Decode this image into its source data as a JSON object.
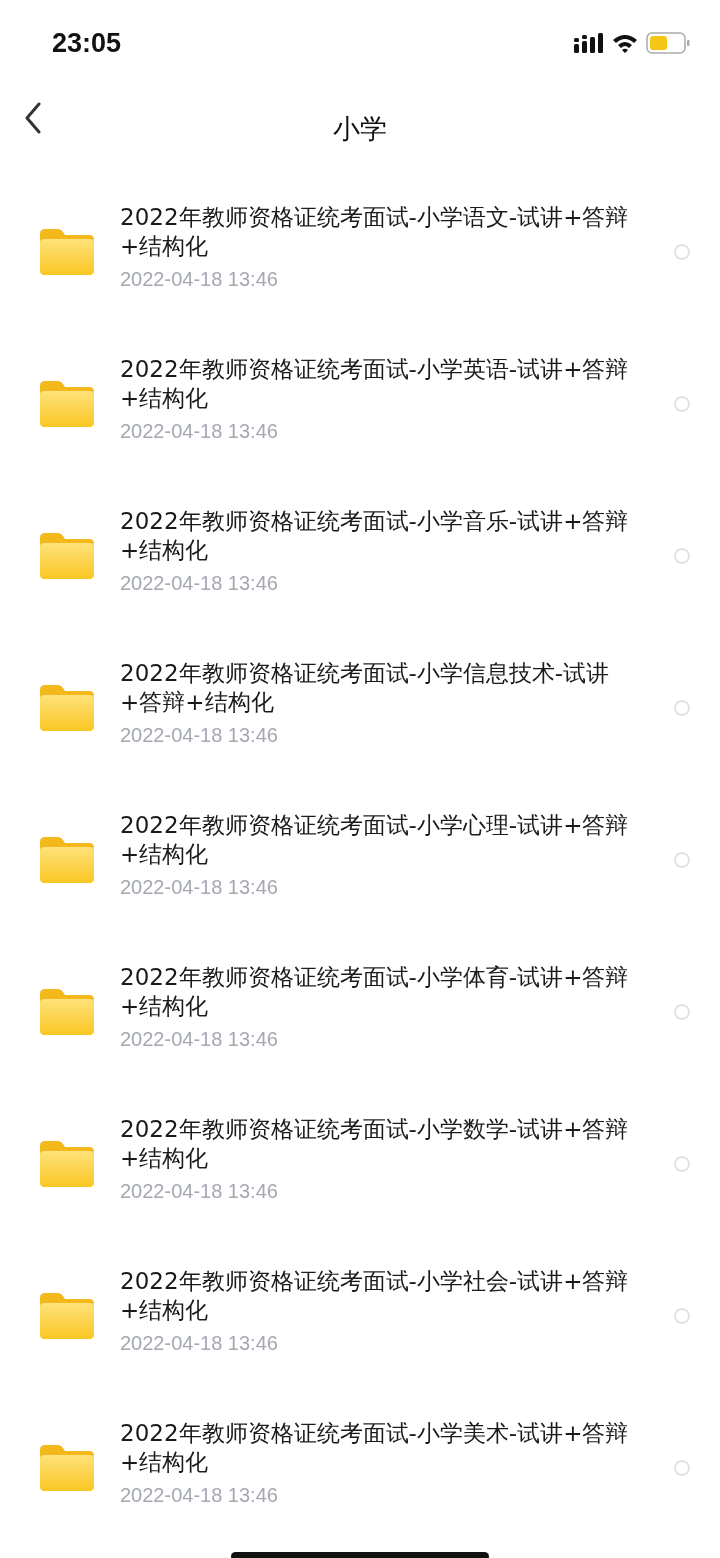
{
  "status_bar": {
    "time": "23:05"
  },
  "header": {
    "title": "小学"
  },
  "items": [
    {
      "name": "2022年教师资格证统考面试-小学语文-试讲+答辩+结构化",
      "date": "2022-04-18 13:46",
      "selected": false
    },
    {
      "name": "2022年教师资格证统考面试-小学英语-试讲+答辩+结构化",
      "date": "2022-04-18 13:46",
      "selected": false
    },
    {
      "name": "2022年教师资格证统考面试-小学音乐-试讲+答辩+结构化",
      "date": "2022-04-18 13:46",
      "selected": false
    },
    {
      "name": "2022年教师资格证统考面试-小学信息技术-试讲+答辩+结构化",
      "date": "2022-04-18 13:46",
      "selected": false
    },
    {
      "name": "2022年教师资格证统考面试-小学心理-试讲+答辩+结构化",
      "date": "2022-04-18 13:46",
      "selected": false
    },
    {
      "name": "2022年教师资格证统考面试-小学体育-试讲+答辩+结构化",
      "date": "2022-04-18 13:46",
      "selected": false
    },
    {
      "name": "2022年教师资格证统考面试-小学数学-试讲+答辩+结构化",
      "date": "2022-04-18 13:46",
      "selected": false
    },
    {
      "name": "2022年教师资格证统考面试-小学社会-试讲+答辩+结构化",
      "date": "2022-04-18 13:46",
      "selected": false
    },
    {
      "name": "2022年教师资格证统考面试-小学美术-试讲+答辩+结构化",
      "date": "2022-04-18 13:46",
      "selected": false
    }
  ]
}
